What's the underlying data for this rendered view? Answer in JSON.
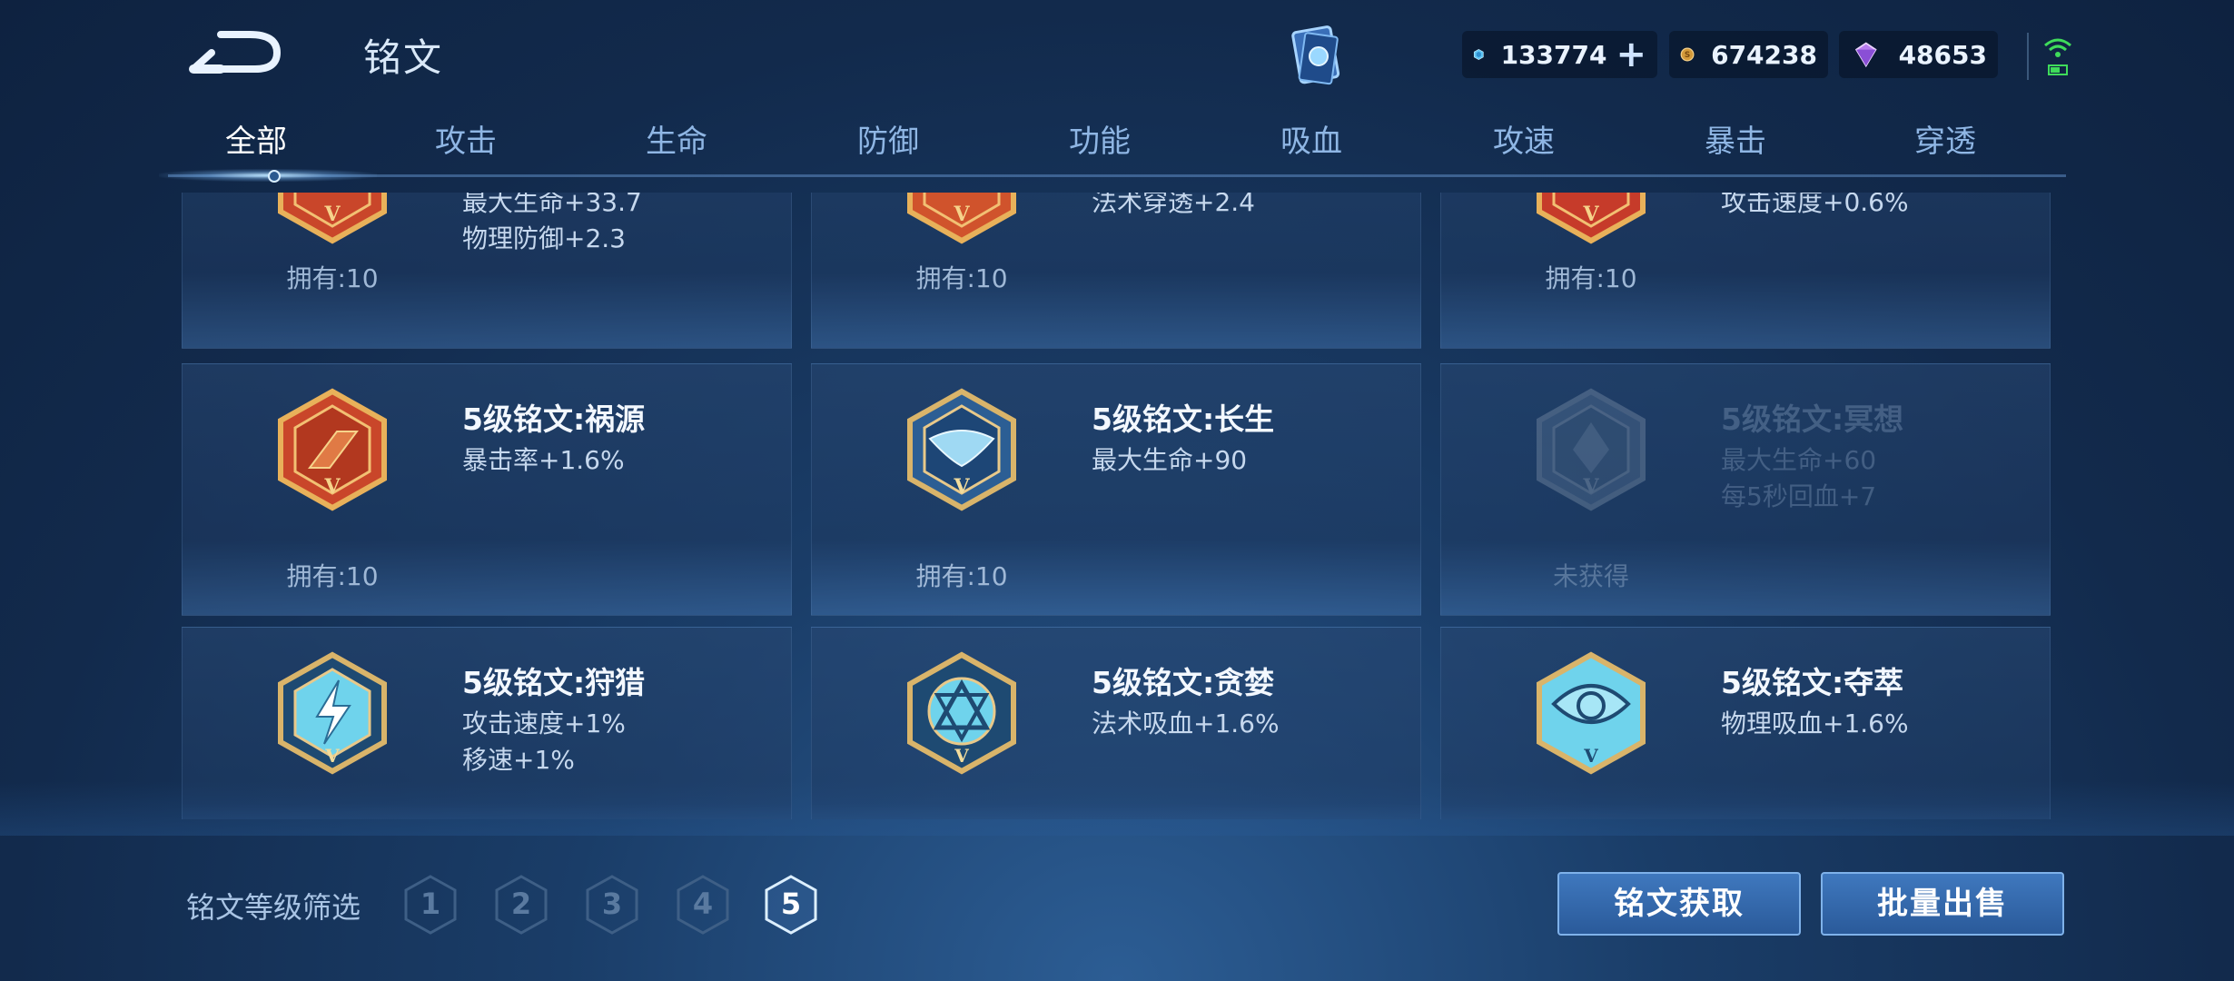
{
  "header": {
    "title": "铭文",
    "currencies": [
      {
        "icon": "diamond-coupon-icon",
        "value": "133774"
      },
      {
        "icon": "gold-coin-icon",
        "value": "674238"
      },
      {
        "icon": "crystal-icon",
        "value": "48653"
      }
    ],
    "plus": "+"
  },
  "tabs": [
    "全部",
    "攻击",
    "生命",
    "防御",
    "功能",
    "吸血",
    "攻速",
    "暴击",
    "穿透"
  ],
  "active_tab": "全部",
  "cards": [
    {
      "name": "",
      "attrs": [
        "最大生命+33.7",
        "物理防御+2.3"
      ],
      "owned": "拥有:10",
      "color": "red"
    },
    {
      "name": "",
      "attrs": [
        "法术穿透+2.4"
      ],
      "owned": "拥有:10",
      "color": "red"
    },
    {
      "name": "",
      "attrs": [
        "攻击速度+0.6%"
      ],
      "owned": "拥有:10",
      "color": "red"
    },
    {
      "name": "5级铭文:祸源",
      "attrs": [
        "暴击率+1.6%"
      ],
      "owned": "拥有:10",
      "color": "red"
    },
    {
      "name": "5级铭文:长生",
      "attrs": [
        "最大生命+90"
      ],
      "owned": "拥有:10",
      "color": "blue"
    },
    {
      "name": "5级铭文:冥想",
      "attrs": [
        "最大生命+60",
        "每5秒回血+7"
      ],
      "owned": "未获得",
      "color": "blue",
      "locked": true
    },
    {
      "name": "5级铭文:狩猎",
      "attrs": [
        "攻击速度+1%",
        "移速+1%"
      ],
      "owned": "",
      "color": "cyan"
    },
    {
      "name": "5级铭文:贪婪",
      "attrs": [
        "法术吸血+1.6%"
      ],
      "owned": "",
      "color": "cyan"
    },
    {
      "name": "5级铭文:夺萃",
      "attrs": [
        "物理吸血+1.6%"
      ],
      "owned": "",
      "color": "cyan"
    }
  ],
  "filter": {
    "label": "铭文等级筛选",
    "levels": [
      "1",
      "2",
      "3",
      "4",
      "5"
    ],
    "active": "5"
  },
  "buttons": {
    "obtain": "铭文获取",
    "bulk_sell": "批量出售"
  },
  "colors": {
    "accent": "#3f78be",
    "text": "#cfe0f5",
    "red_emblem": "#c9462a",
    "cyan_emblem": "#6fd3ec"
  }
}
